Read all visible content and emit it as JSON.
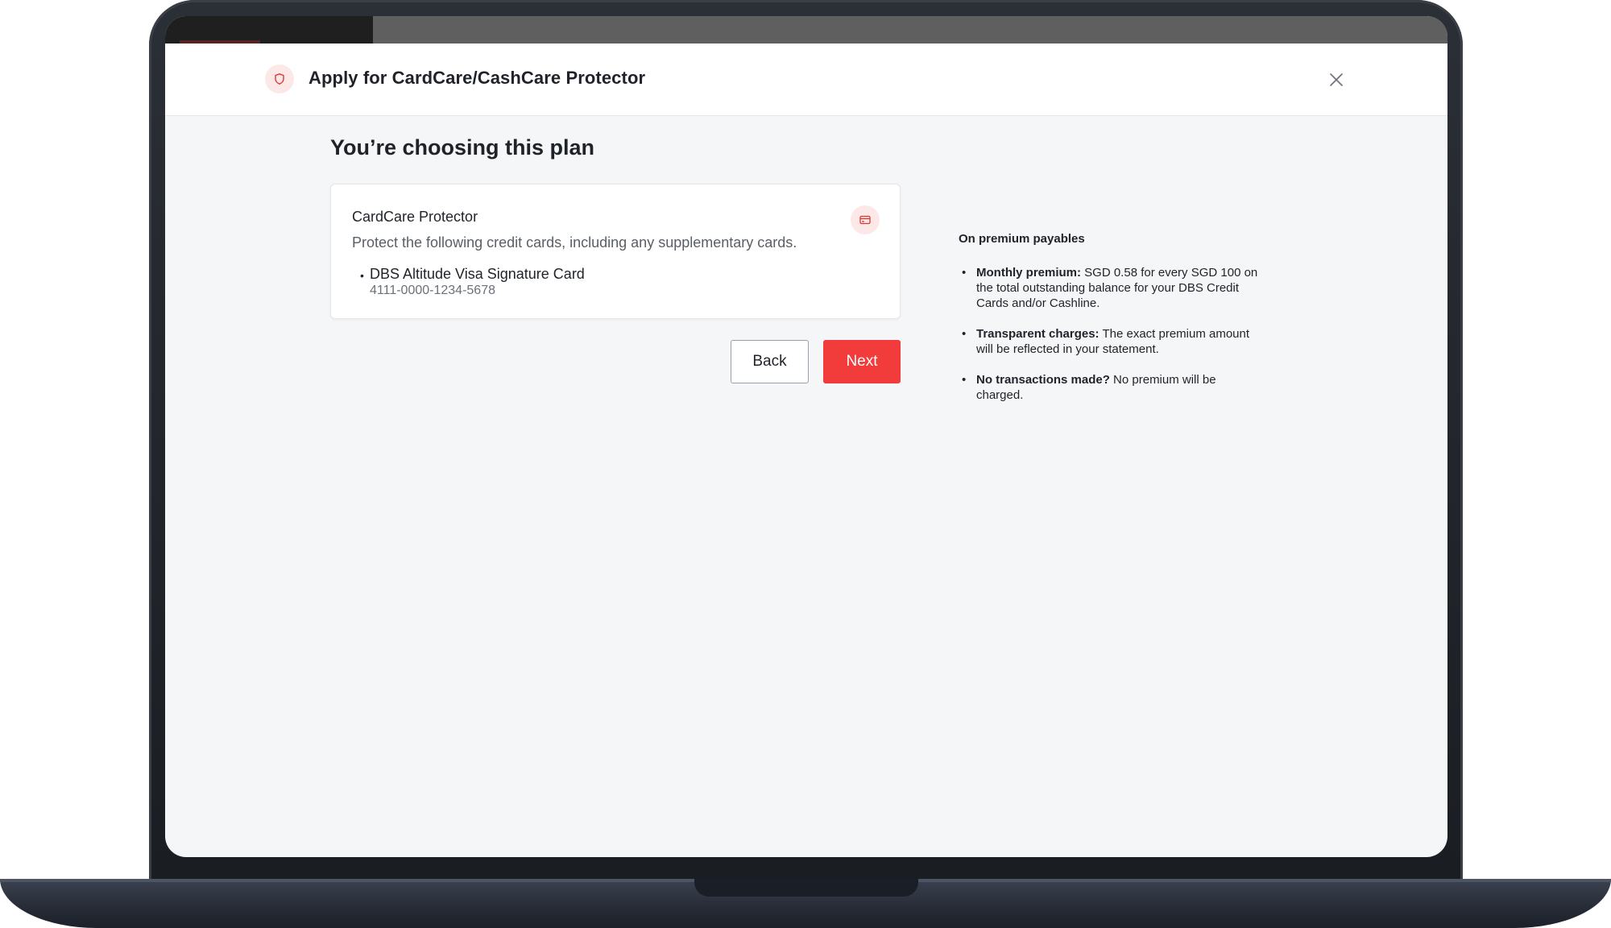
{
  "modal": {
    "title": "Apply for CardCare/CashCare Protector",
    "header_icon": "shield-icon",
    "close_icon": "close-icon"
  },
  "page": {
    "heading": "You’re choosing this plan"
  },
  "plan_card": {
    "name": "CardCare Protector",
    "description": "Protect the following credit cards, including any supplementary cards.",
    "icon": "credit-card-icon",
    "cards": [
      {
        "name": "DBS Altitude Visa Signature Card",
        "number": "4111-0000-1234-5678"
      }
    ]
  },
  "actions": {
    "back_label": "Back",
    "next_label": "Next"
  },
  "info": {
    "title": "On premium payables",
    "items": [
      {
        "lead": "Monthly premium:",
        "text": " SGD 0.58 for every SGD 100 on the total outstanding balance for your DBS Credit Cards and/or Cashline."
      },
      {
        "lead": "Transparent charges:",
        "text": " The exact premium amount will be reflected in your statement."
      },
      {
        "lead": "No transactions made?",
        "text": " No premium will be charged."
      }
    ]
  },
  "colors": {
    "accent": "#f23b3b",
    "accent_light": "#fde8e8",
    "background": "#f5f6f8",
    "text": "#1f2329"
  }
}
